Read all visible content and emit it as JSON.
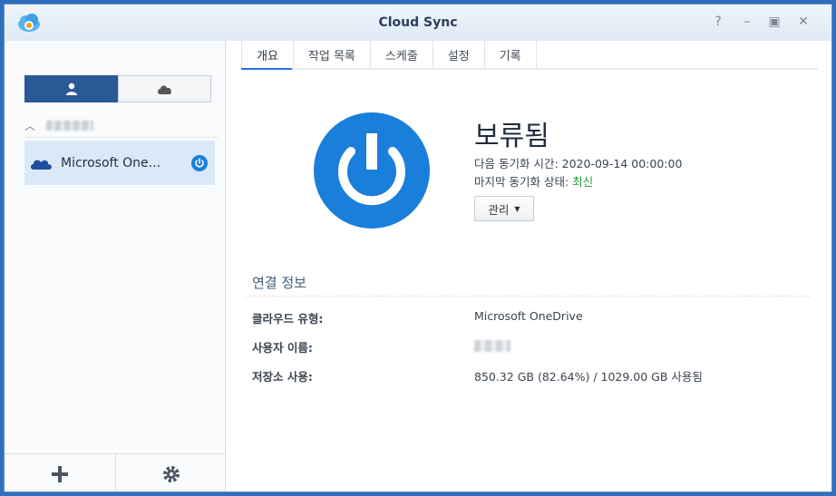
{
  "window": {
    "title": "Cloud Sync"
  },
  "sidebar": {
    "tasks": [
      {
        "label": "Microsoft One..."
      }
    ],
    "icons": [
      "user-icon",
      "cloud-icon",
      "chevron-up-icon",
      "onedrive-icon",
      "power-status-icon",
      "add-icon",
      "gear-icon"
    ]
  },
  "tabs": [
    {
      "label": "개요"
    },
    {
      "label": "작업 목록"
    },
    {
      "label": "스케줄"
    },
    {
      "label": "설정"
    },
    {
      "label": "기록"
    }
  ],
  "overview": {
    "status": "보류됨",
    "next_sync_label": "다음 동기화 시간: ",
    "next_sync_value": "2020-09-14 00:00:00",
    "last_state_label": "마지막 동기화 상태: ",
    "last_state_value": "최신",
    "manage_label": "관리"
  },
  "connection": {
    "title": "연결 정보",
    "cloud_type_label": "클라우드 유형:",
    "cloud_type_value": "Microsoft OneDrive",
    "username_label": "사용자 이름:",
    "storage_label": "저장소 사용:",
    "storage_value": "850.32 GB (82.64%) / 1029.00 GB 사용됨"
  },
  "colors": {
    "accent": "#1a7fdb",
    "selected": "#dbe8f8",
    "ok": "#1e9b38",
    "segment_active": "#2a5a96"
  }
}
